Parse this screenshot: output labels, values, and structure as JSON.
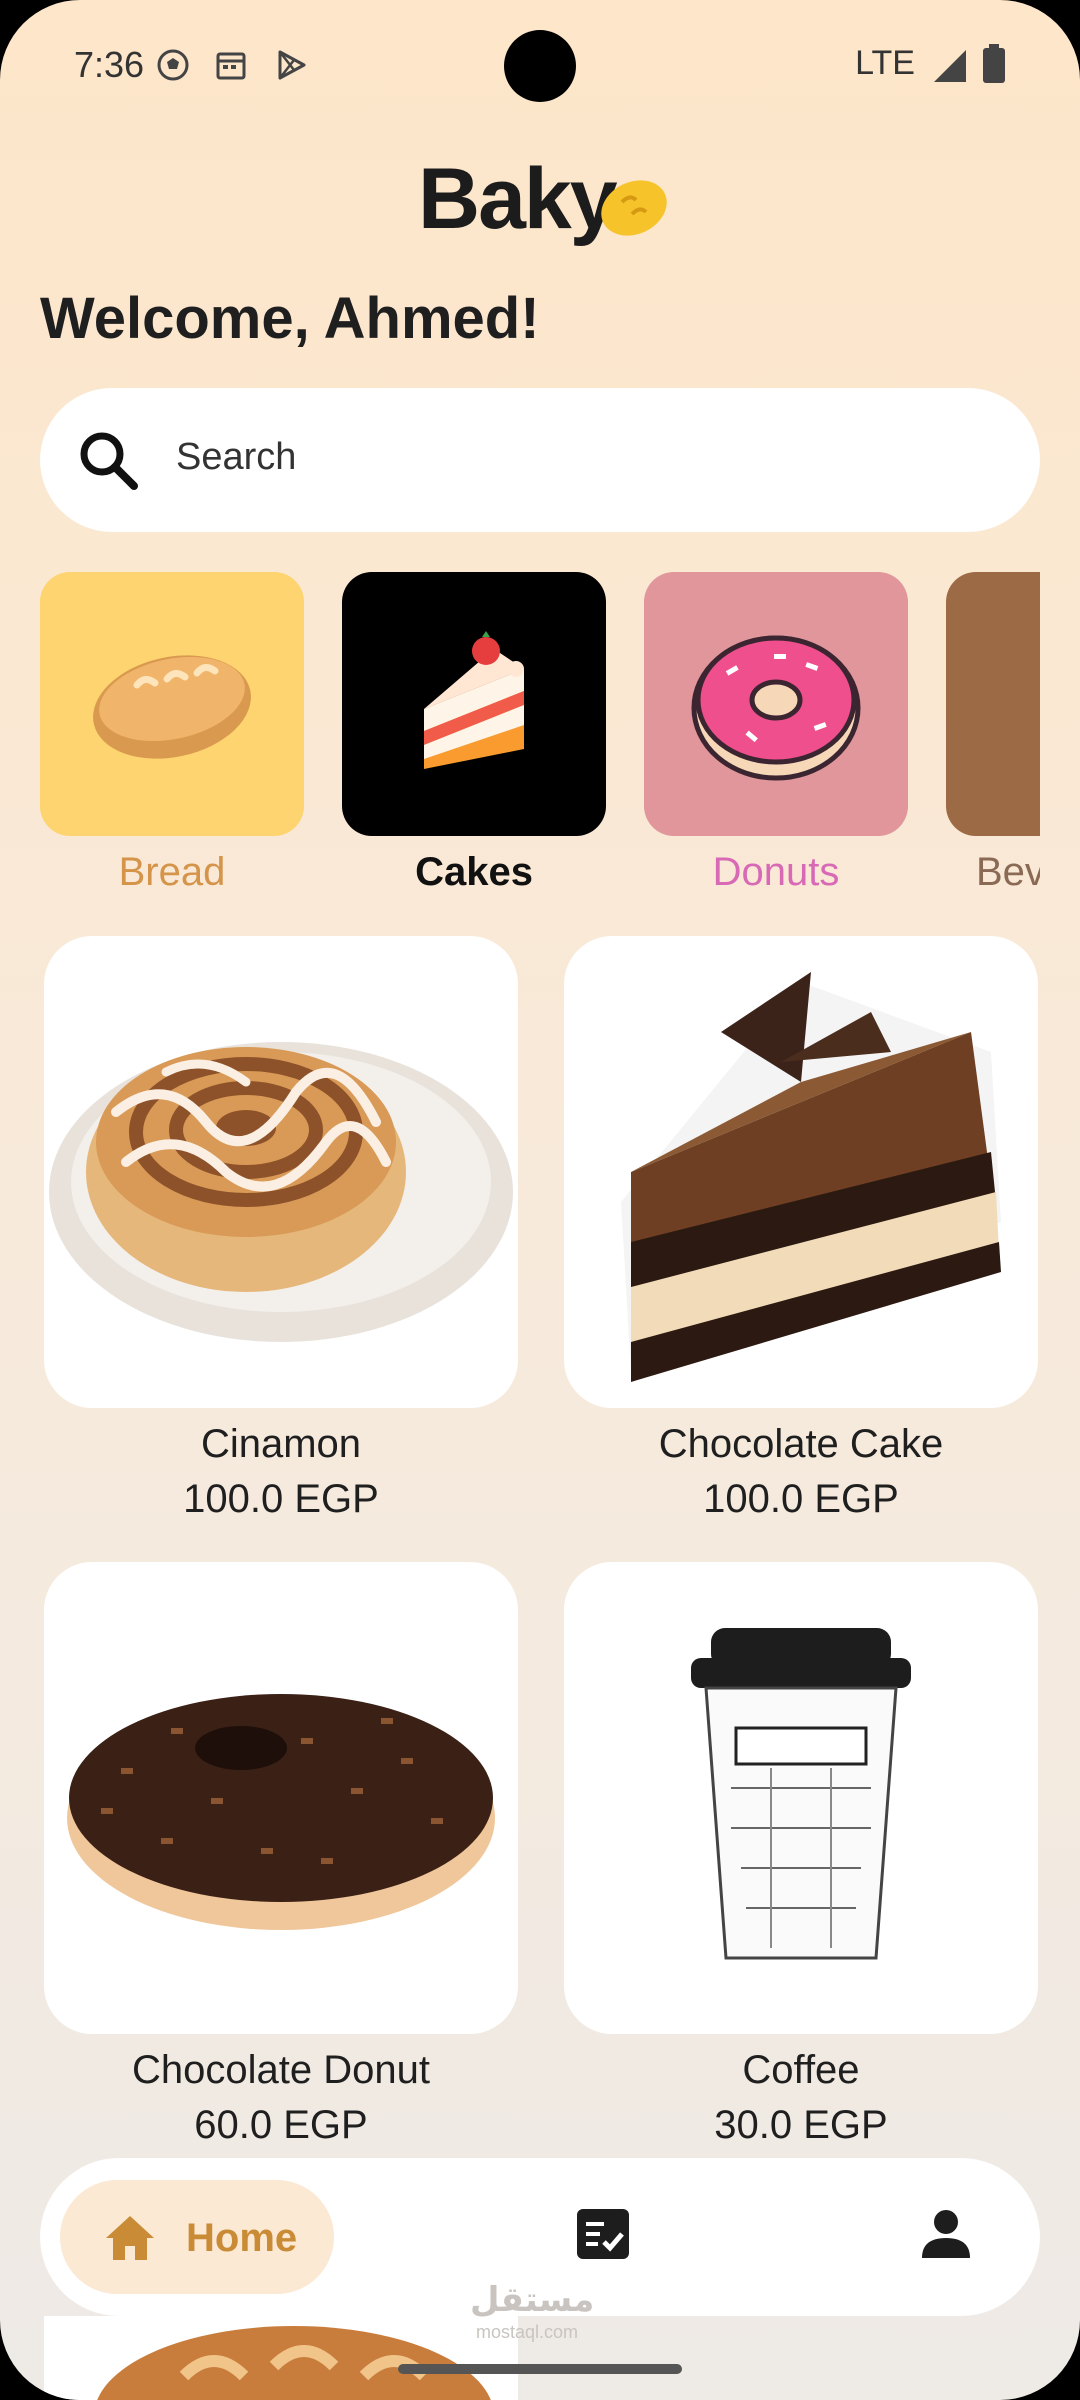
{
  "status_bar": {
    "time": "7:36",
    "network": "LTE"
  },
  "app": {
    "name": "Baky"
  },
  "welcome": "Welcome, Ahmed!",
  "search": {
    "placeholder": "Search"
  },
  "categories": [
    {
      "label": "Bread",
      "color": "#d4944a",
      "bg": "#fdd46f"
    },
    {
      "label": "Cakes",
      "color": "#111111",
      "bg": "#000000"
    },
    {
      "label": "Donuts",
      "color": "#d86ab5",
      "bg": "#e0969a"
    },
    {
      "label": "Bev",
      "color": "#8a6a55",
      "bg": "#9c6a45"
    }
  ],
  "products": [
    {
      "name": "Cinamon",
      "price": "100.0 EGP",
      "icon": "cinnamon-roll-icon"
    },
    {
      "name": "Chocolate Cake",
      "price": "100.0 EGP",
      "icon": "chocolate-cake-icon"
    },
    {
      "name": "Chocolate Donut",
      "price": "60.0 EGP",
      "icon": "chocolate-donut-icon"
    },
    {
      "name": "Coffee",
      "price": "30.0 EGP",
      "icon": "coffee-cup-icon"
    }
  ],
  "bottom_nav": {
    "home_label": "Home",
    "accent": "#c98b36"
  },
  "watermark": {
    "text": "مستقل",
    "sub": "mostaql.com"
  }
}
